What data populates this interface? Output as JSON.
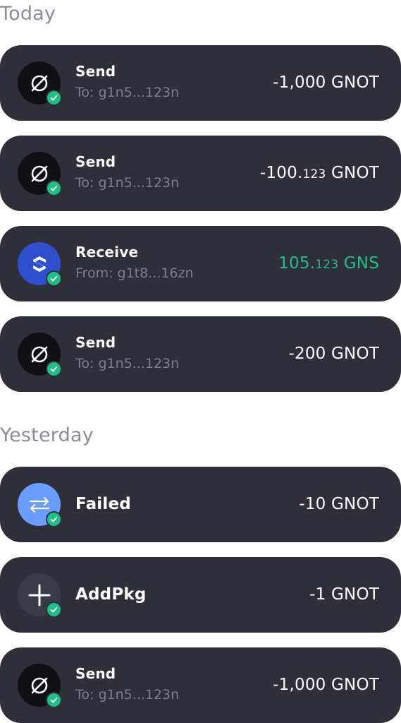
{
  "sections": {
    "today": "Today",
    "yesterday": "Yesterday"
  },
  "colors": {
    "card_bg": "#2e2f39",
    "success_green": "#1fbf85",
    "gns_blue": "#2f4fcf",
    "swap_blue": "#6b9cff"
  },
  "transactions": [
    {
      "icon": "gnot-token-icon",
      "title": "Send",
      "subtitle": "To: g1n5...123n",
      "amount_int": "-1,000",
      "amount_frac": "",
      "unit": "GNOT"
    },
    {
      "icon": "gnot-token-icon",
      "title": "Send",
      "subtitle": "To: g1n5...123n",
      "amount_int": "-100.",
      "amount_frac": "123",
      "unit": "GNOT"
    },
    {
      "icon": "gns-token-icon",
      "title": "Receive",
      "subtitle": "From: g1t8...16zn",
      "amount_int": "105.",
      "amount_frac": "123",
      "unit": "GNS"
    },
    {
      "icon": "gnot-token-icon",
      "title": "Send",
      "subtitle": "To: g1n5...123n",
      "amount_int": "-200",
      "amount_frac": "",
      "unit": "GNOT"
    },
    {
      "icon": "swap-arrows-icon",
      "title": "Failed",
      "amount_int": "-10",
      "amount_frac": "",
      "unit": "GNOT"
    },
    {
      "icon": "plus-icon",
      "title": "AddPkg",
      "amount_int": "-1",
      "amount_frac": "",
      "unit": "GNOT"
    },
    {
      "icon": "gnot-token-icon",
      "title": "Send",
      "subtitle": "To: g1n5...123n",
      "amount_int": "-1,000",
      "amount_frac": "",
      "unit": "GNOT"
    }
  ]
}
